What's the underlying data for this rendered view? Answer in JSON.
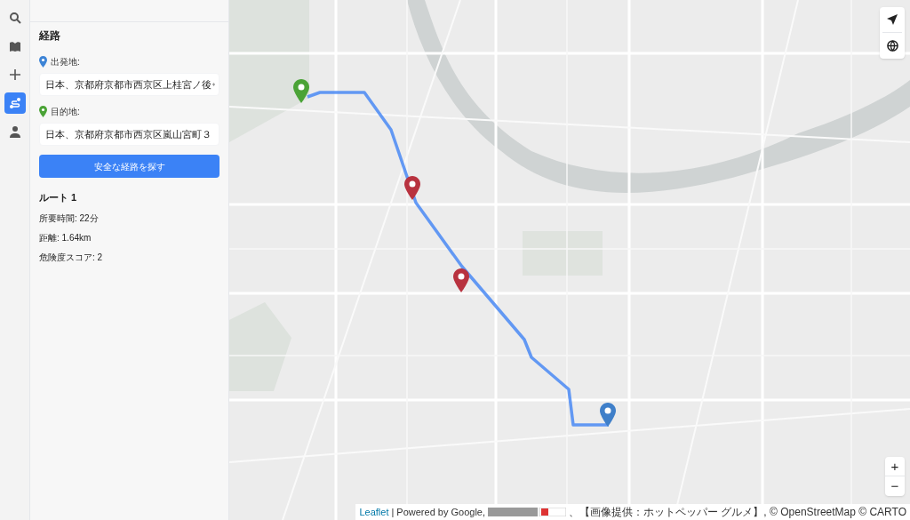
{
  "rail": [
    {
      "kind": "search",
      "selected": false
    },
    {
      "kind": "book",
      "selected": false
    },
    {
      "kind": "add",
      "selected": false
    },
    {
      "kind": "route",
      "selected": true
    },
    {
      "kind": "user",
      "selected": false
    }
  ],
  "panel": {
    "title": "経路",
    "origin": {
      "label": "出発地:",
      "value": "日本、京都府京都市西京区上桂宮ノ後"
    },
    "destination": {
      "label": "目的地:",
      "value": "日本、京都府京都市西京区嵐山宮町３"
    },
    "button": "安全な経路を探す",
    "route": {
      "heading": "ルート 1",
      "stats": [
        "所要時間: 22分",
        "距離: 1.64km",
        "危険度スコア: 2"
      ]
    }
  },
  "map": {
    "markers": [
      {
        "color": "#4aa336"
      },
      {
        "color": "#b8323f"
      },
      {
        "color": "#b8323f"
      },
      {
        "color": "#3f7fc9"
      }
    ],
    "zoom": [
      "+",
      "−"
    ],
    "attribution": {
      "link": "Leaflet",
      "text": "| Powered by Google,",
      "text2": "、【画像提供：ホットペッパー グルメ】, © OpenStreetMap © CARTO"
    }
  }
}
